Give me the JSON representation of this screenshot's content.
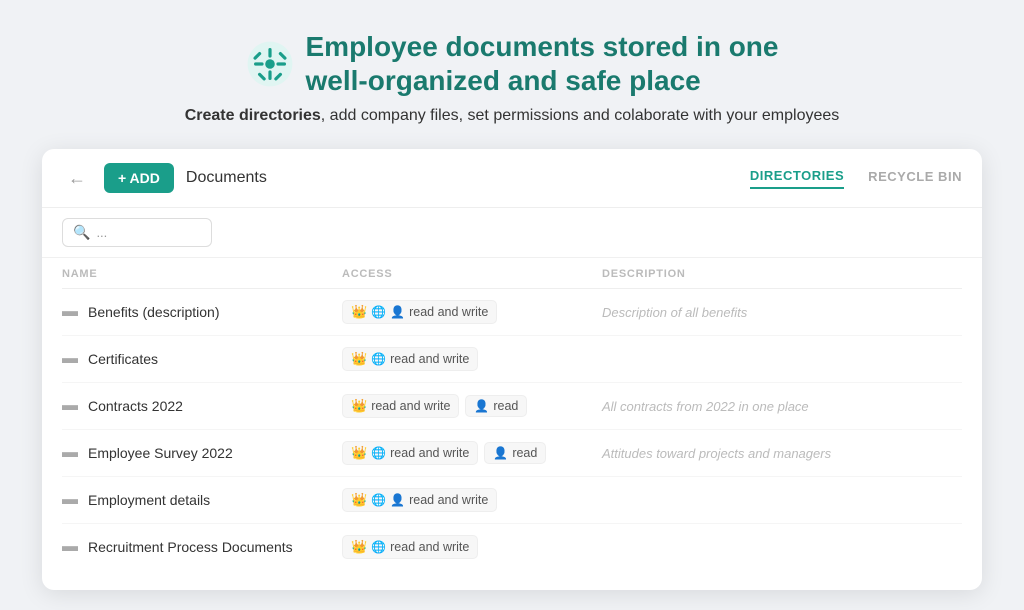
{
  "header": {
    "title_line1": "Employee documents stored in one",
    "title_line2": "well-organized and safe place",
    "subtitle_bold": "Create directories",
    "subtitle_rest": ", add company files, set permissions and colaborate with your employees"
  },
  "toolbar": {
    "back_label": "←",
    "add_label": "+ ADD",
    "breadcrumb": "Documents",
    "tabs": [
      {
        "label": "DIRECTORIES",
        "active": true
      },
      {
        "label": "RECYCLE BIN",
        "active": false
      }
    ]
  },
  "search": {
    "placeholder": "..."
  },
  "table": {
    "columns": [
      "NAME",
      "ACCESS",
      "DESCRIPTION"
    ],
    "rows": [
      {
        "name": "Benefits (description)",
        "access_main": "read and write",
        "access_icons": [
          "crown",
          "globe",
          "person"
        ],
        "access_secondary": null,
        "description": "Description of all benefits"
      },
      {
        "name": "Certificates",
        "access_main": "read and write",
        "access_icons": [
          "crown",
          "globe"
        ],
        "access_secondary": null,
        "description": ""
      },
      {
        "name": "Contracts 2022",
        "access_main": "read and write",
        "access_icons": [
          "crown"
        ],
        "access_secondary": "read",
        "access_secondary_icons": [
          "person"
        ],
        "description": "All contracts from 2022 in one place"
      },
      {
        "name": "Employee Survey 2022",
        "access_main": "read and write",
        "access_icons": [
          "crown",
          "globe"
        ],
        "access_secondary": "read",
        "access_secondary_icons": [
          "person"
        ],
        "description": "Attitudes toward projects and managers"
      },
      {
        "name": "Employment details",
        "access_main": "read and write",
        "access_icons": [
          "crown",
          "globe",
          "person"
        ],
        "access_secondary": null,
        "description": ""
      },
      {
        "name": "Recruitment Process Documents",
        "access_main": "read and write",
        "access_icons": [
          "crown",
          "globe"
        ],
        "access_secondary": null,
        "description": ""
      }
    ]
  }
}
